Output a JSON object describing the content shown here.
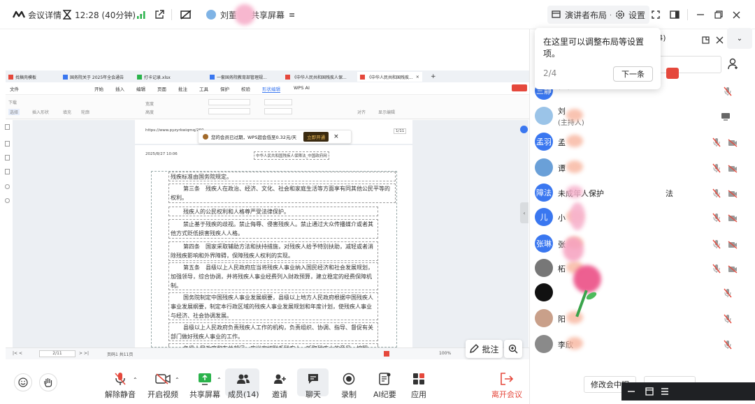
{
  "titlebar": {
    "meeting_details": "会议详情",
    "timer": "12:28 (40分钟)",
    "presenter_name": "刘董",
    "screen_share": "共享屏幕",
    "layout_button": "演讲者布局",
    "settings_button": "设置"
  },
  "tooltip": {
    "text": "在这里可以调整布局等设置项。",
    "step": "2/4",
    "next_button": "下一条"
  },
  "panel": {
    "title_count": "(14)",
    "members": [
      {
        "avatar_text": "三静",
        "avatar_color": "#3a77f0",
        "name": "",
        "role": "(我)"
      },
      {
        "avatar_text": "",
        "avatar_color": "#9bc4e8",
        "name": "刘",
        "role": "(主持人)"
      },
      {
        "avatar_text": "孟羽",
        "avatar_color": "#3a77f0",
        "name": "孟",
        "role": ""
      },
      {
        "avatar_text": "",
        "avatar_color": "#6aa0d8",
        "name": "谭",
        "role": ""
      },
      {
        "avatar_text": "障法",
        "avatar_color": "#3a77f0",
        "name": "未成年人保护",
        "suffix": "法",
        "role": ""
      },
      {
        "avatar_text": "儿",
        "avatar_color": "#3a77f0",
        "name": "小",
        "role": ""
      },
      {
        "avatar_text": "张琳",
        "avatar_color": "#3a77f0",
        "name": "张",
        "role": ""
      },
      {
        "avatar_text": "",
        "avatar_color": "#777",
        "name": "柘",
        "role": ""
      },
      {
        "avatar_text": "",
        "avatar_color": "#111",
        "name": "",
        "role": ""
      },
      {
        "avatar_text": "",
        "avatar_color": "#c9a08a",
        "name": "阳",
        "role": ""
      },
      {
        "avatar_text": "",
        "avatar_color": "#8a8a8a",
        "name": "李欣",
        "role": ""
      }
    ],
    "modify_nickname": "修改会中昵"
  },
  "toolbar": {
    "unmute": "解除静音",
    "start_video": "开启视频",
    "share_screen": "共享屏幕",
    "members": "成员(14)",
    "invite": "邀请",
    "chat": "聊天",
    "record": "录制",
    "ai_minutes": "AI纪要",
    "apps": "应用",
    "leave": "离开会议"
  },
  "annotate_button": "批注",
  "wps": {
    "tabs": [
      "找稿壳模板",
      "国务院关于 2025年全会通告",
      "打卡记录.xlsx",
      "一套国务院教育部管理规...",
      "《中华人民共和国残疾人保...",
      "《中华人民共和国残疾..."
    ],
    "menu": [
      "文件",
      "开始",
      "插入",
      "编辑",
      "页面",
      "批注",
      "工具",
      "保护",
      "校验",
      "形状编辑",
      "WPS AI"
    ],
    "ribbon": [
      "下载",
      "选择",
      "插入形状",
      "填充",
      "轮廓",
      "宽度",
      "高度",
      "对齐",
      "显示编辑"
    ],
    "url": "https://www.pyzyrkwiqmq/260",
    "membership_notice": "您的会员已过期，WPS超会低至0.32元/天",
    "renew_button": "立即开通",
    "date_stamp": "2025/8/27 10:06",
    "header_title": "中华人民共和国残疾人保障法_中国政府网",
    "page_info": "2/11",
    "page_footer": "页码1 共11页",
    "zoom": "100%",
    "paragraphs": [
      "残疾标准由国务院规定。",
      "第三条　残疾人在政治、经济、文化、社会和家庭生活等方面享有同其他公民平等的权利。",
      "残疾人的公民权利和人格尊严受法律保护。",
      "禁止基于残疾的歧视。禁止侮辱、侵害残疾人。禁止通过大众传播媒介或者其他方式贬低损害残疾人人格。",
      "第四条　国家采取辅助方法和扶持措施，对残疾人给予特别扶助，减轻或者消除残疾影响和外界障碍，保障残疾人权利的实现。",
      "第五条　县级以上人民政府应当将残疾人事业纳入国民经济和社会发展规划，加强领导，综合协调，并将残疾人事业经费列入财政预算，建立稳定的经费保障机制。",
      "国务院制定中国残疾人事业发展纲要，县级以上地方人民政府根据中国残疾人事业发展纲要，制定本行政区域的残疾人事业发展规划和年度计划，使残疾人事业与经济、社会协调发展。",
      "县级以上人民政府负责残疾人工作的机构，负责组织、协调、指导、督促有关部门做好残疾人事业的工作。",
      "各级人民政府和有关部门，应当密切联系残疾人，听取残疾人的意见，按照"
    ]
  },
  "colors": {
    "accent": "#3a77f0",
    "leave_red": "#e5483c",
    "mic_off_red": "#e5483c",
    "signal_green": "#2ab34b"
  }
}
